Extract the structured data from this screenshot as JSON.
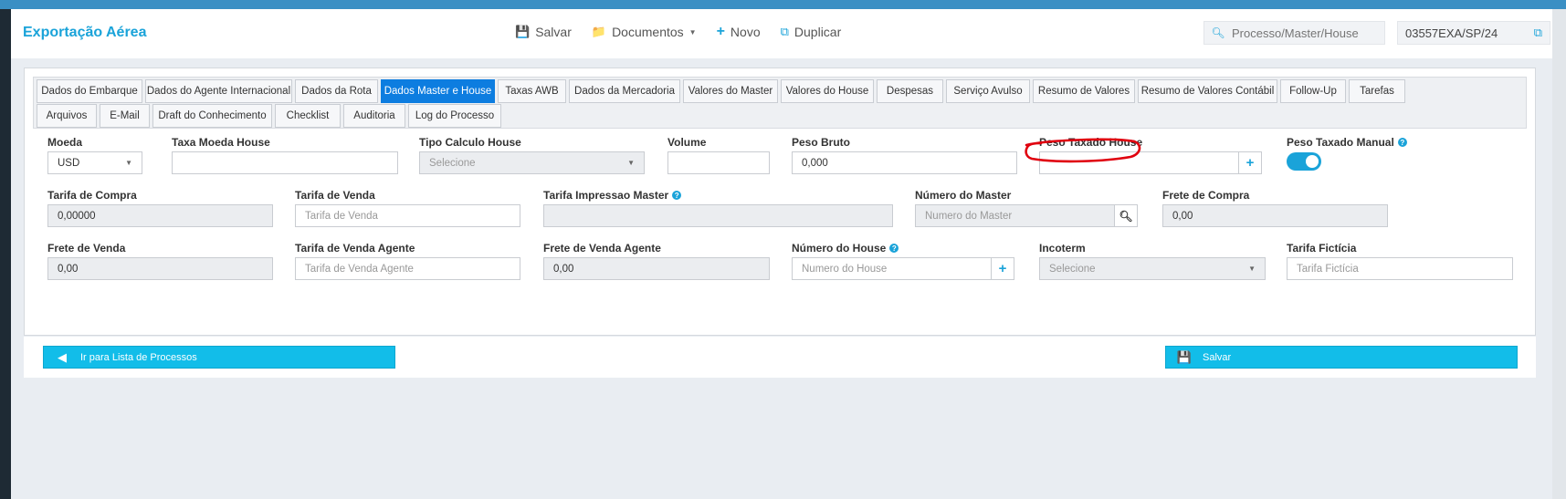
{
  "header": {
    "title": "Exportação Aérea",
    "toolbar": {
      "save": "Salvar",
      "documents": "Documentos",
      "new": "Novo",
      "duplicate": "Duplicar"
    },
    "search_placeholder": "Processo/Master/House",
    "process_number": "03557EXA/SP/24"
  },
  "tabs": [
    "Dados do Embarque",
    "Dados do Agente Internacional",
    "Dados da Rota",
    "Dados Master e House",
    "Taxas AWB",
    "Dados da Mercadoria",
    "Valores do Master",
    "Valores do House",
    "Despesas",
    "Serviço Avulso",
    "Resumo de Valores",
    "Resumo de Valores Contábil",
    "Follow-Up",
    "Tarefas",
    "Arquivos",
    "E-Mail",
    "Draft do Conhecimento",
    "Checklist",
    "Auditoria",
    "Log do Processo"
  ],
  "active_tab": "Dados Master e House",
  "form": {
    "moeda": {
      "label": "Moeda",
      "value": "USD"
    },
    "taxa_moeda_house": {
      "label": "Taxa Moeda House",
      "value": ""
    },
    "tipo_calculo_house": {
      "label": "Tipo Calculo House",
      "placeholder": "Selecione"
    },
    "volume": {
      "label": "Volume",
      "value": ""
    },
    "peso_bruto": {
      "label": "Peso Bruto",
      "value": "0,000"
    },
    "peso_taxado_house": {
      "label": "Peso Taxado House",
      "value": ""
    },
    "peso_taxado_manual": {
      "label": "Peso Taxado Manual",
      "on": true
    },
    "tarifa_compra": {
      "label": "Tarifa de Compra",
      "value": "0,00000"
    },
    "tarifa_venda": {
      "label": "Tarifa de Venda",
      "placeholder": "Tarifa de Venda"
    },
    "tarifa_impressao_master": {
      "label": "Tarifa Impressao Master",
      "value": ""
    },
    "numero_master": {
      "label": "Número do Master",
      "placeholder": "Numero do Master"
    },
    "frete_compra": {
      "label": "Frete de Compra",
      "value": "0,00"
    },
    "frete_venda": {
      "label": "Frete de Venda",
      "value": "0,00"
    },
    "tarifa_venda_agente": {
      "label": "Tarifa de Venda Agente",
      "placeholder": "Tarifa de Venda Agente"
    },
    "frete_venda_agente": {
      "label": "Frete de Venda Agente",
      "value": "0,00"
    },
    "numero_house": {
      "label": "Número do House",
      "placeholder": "Numero do House"
    },
    "incoterm": {
      "label": "Incoterm",
      "placeholder": "Selecione"
    },
    "tarifa_ficticia": {
      "label": "Tarifa Fictícia",
      "placeholder": "Tarifa Fictícia"
    }
  },
  "footer": {
    "back": "Ir para Lista de Processos",
    "save": "Salvar"
  },
  "colors": {
    "accent": "#1aa3d9",
    "active_tab": "#0d7de0",
    "button": "#12bde9",
    "annotation": "#e0000e"
  }
}
